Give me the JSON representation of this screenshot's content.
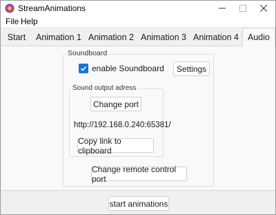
{
  "window": {
    "title": "StreamAnimations",
    "minimize_icon": "minimize-icon",
    "maximize_icon": "maximize-icon",
    "close_icon": "close-icon",
    "app_icon": "app-icon"
  },
  "menu": {
    "items": [
      "File",
      "Help"
    ]
  },
  "tabs": [
    {
      "label": "Start",
      "selected": false
    },
    {
      "label": "Animation 1",
      "selected": false
    },
    {
      "label": "Animation 2",
      "selected": false
    },
    {
      "label": "Animation 3",
      "selected": false
    },
    {
      "label": "Animation 4",
      "selected": false
    },
    {
      "label": "Audio",
      "selected": true
    }
  ],
  "soundboard": {
    "group_label": "Soundboard",
    "enable_label": "enable Soundboard",
    "enable_checked": true,
    "settings_label": "Settings",
    "output": {
      "group_label": "Sound output adress",
      "change_port_label": "Change port",
      "address": "http://192.168.0.240:65381/",
      "copy_link_label": "Copy link to clipboard"
    },
    "remote_port_label": "Change remote control port"
  },
  "footer": {
    "start_label": "start animations"
  },
  "colors": {
    "accent": "#1a74d3",
    "window_bg": "#f0f0f0",
    "content_bg": "#f9f9f9"
  }
}
